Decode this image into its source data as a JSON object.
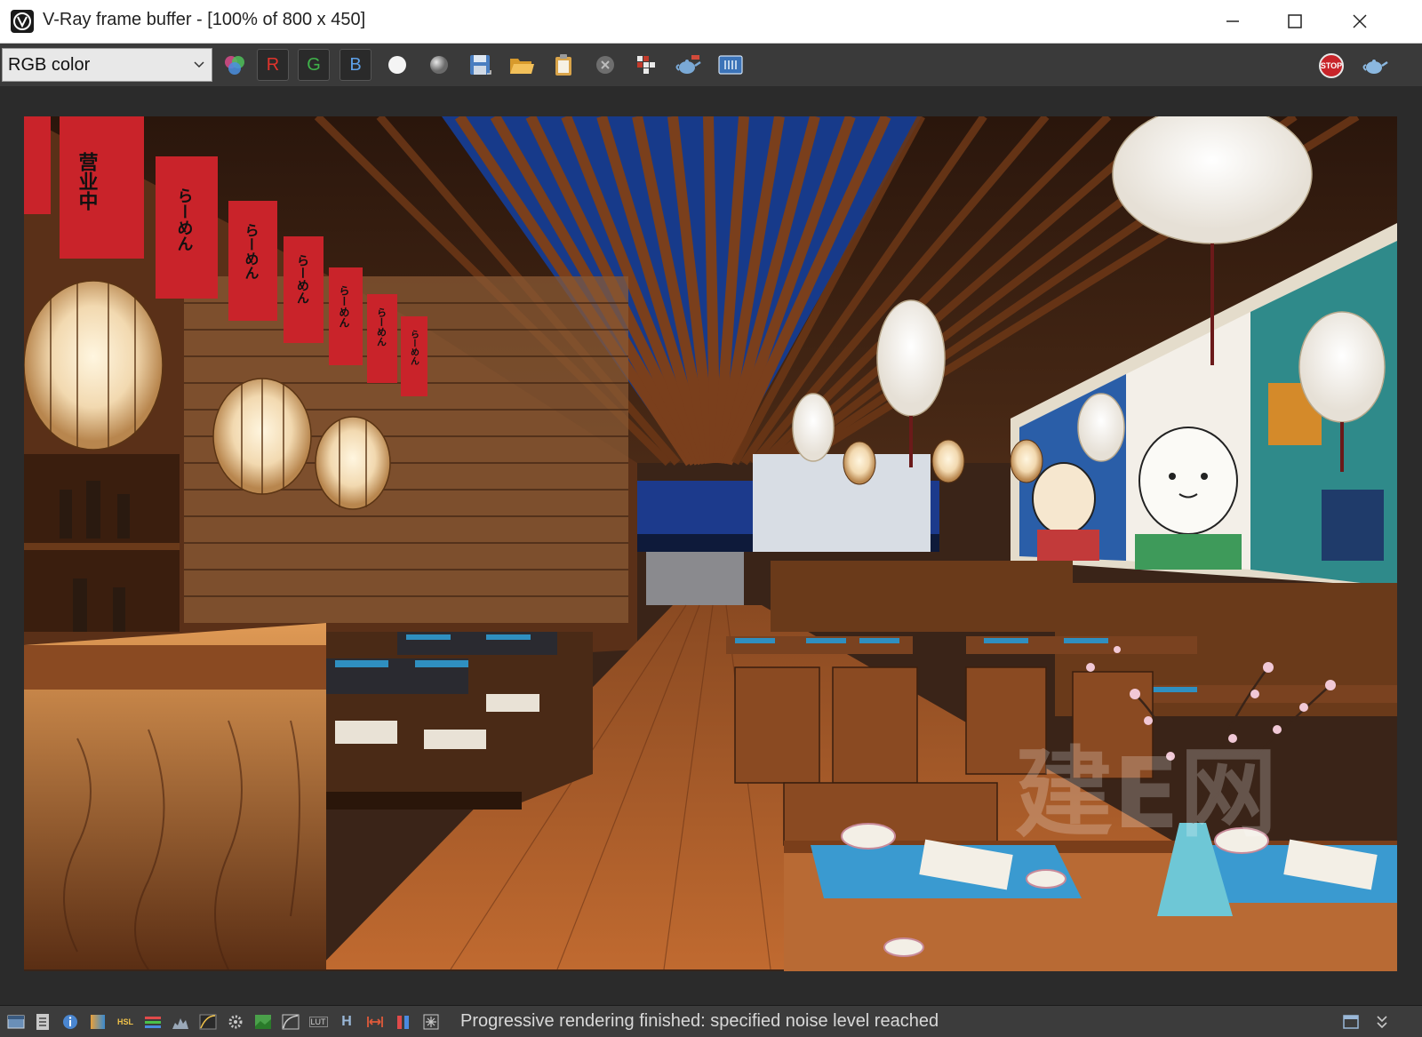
{
  "window": {
    "title": "V-Ray frame buffer - [100% of 800 x 450]",
    "minimize_glyph": "—",
    "maximize_glyph": "☐",
    "close_glyph": "✕"
  },
  "toolbar": {
    "channel_value": "RGB color",
    "r_label": "R",
    "g_label": "G",
    "b_label": "B",
    "stop_label": "STOP",
    "r_color": "#e0342c",
    "g_color": "#3fb24a",
    "b_color": "#5da0e8"
  },
  "render": {
    "banner_texts": [
      "营业中",
      "らーめん",
      "らーめん",
      "らーめん",
      "らーめん",
      "らーめん",
      "らーめん"
    ],
    "watermark": "建E网"
  },
  "statusbar": {
    "h_label": "H",
    "lut_label": "LUT",
    "hsl_label": "HSL",
    "message": "Progressive rendering finished: specified noise level reached"
  }
}
